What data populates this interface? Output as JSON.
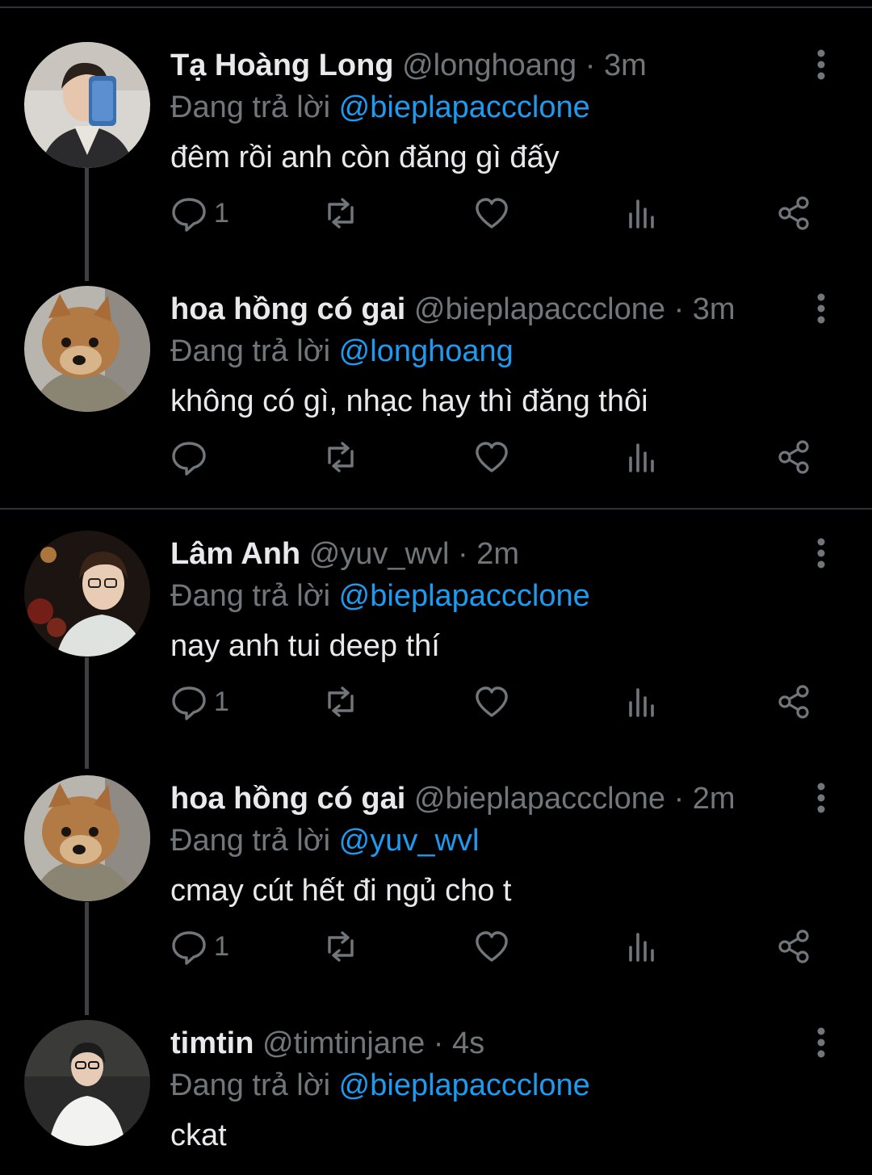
{
  "tweets": [
    {
      "name": "Tạ Hoàng Long",
      "handle": "@longhoang",
      "separator": "·",
      "time": "3m",
      "reply_prefix": "Đang trả lời",
      "reply_to": "@bieplapaccclone",
      "text": "đêm rồi anh còn đăng gì đấy",
      "reply_count": "1",
      "avatar_icon": "person-selfie-avatar"
    },
    {
      "name": "hoa hồng có gai",
      "handle": "@bieplapaccclone",
      "separator": "·",
      "time": "3m",
      "reply_prefix": "Đang trả lời",
      "reply_to": "@longhoang",
      "text": "không có gì, nhạc hay thì đăng thôi",
      "reply_count": "",
      "avatar_icon": "dog-avatar"
    },
    {
      "name": "Lâm Anh",
      "handle": "@yuv_wvl",
      "separator": "·",
      "time": "2m",
      "reply_prefix": "Đang trả lời",
      "reply_to": "@bieplapaccclone",
      "text": "nay anh tui deep thí",
      "reply_count": "1",
      "avatar_icon": "person-night-avatar"
    },
    {
      "name": "hoa hồng có gai",
      "handle": "@bieplapaccclone",
      "separator": "·",
      "time": "2m",
      "reply_prefix": "Đang trả lời",
      "reply_to": "@yuv_wvl",
      "text": "cmay cút hết đi ngủ cho t",
      "reply_count": "1",
      "avatar_icon": "dog-avatar"
    },
    {
      "name": "timtin",
      "handle": "@timtinjane",
      "separator": "·",
      "time": "4s",
      "reply_prefix": "Đang trả lời",
      "reply_to": "@bieplapaccclone",
      "text": "ckat",
      "reply_count": "",
      "avatar_icon": "person-standing-avatar"
    }
  ],
  "colors": {
    "background": "#000000",
    "primary_text": "#e7e9ea",
    "secondary_text": "#71767b",
    "mention": "#1d9bf0",
    "divider": "#2f3336"
  }
}
